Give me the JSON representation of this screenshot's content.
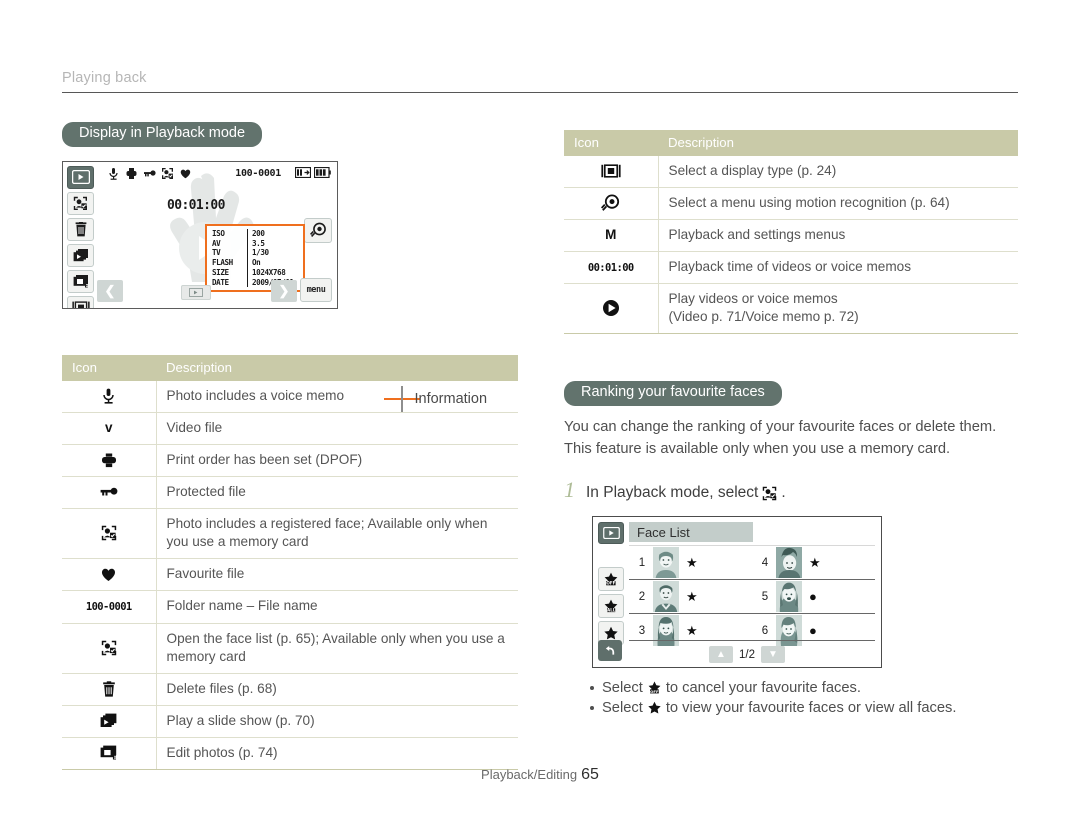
{
  "running_head": "Playing back",
  "footer": {
    "section": "Playback/Editing",
    "page": "65"
  },
  "left_column": {
    "section_title": "Display in Playback mode",
    "callout_label": "Information",
    "lcd": {
      "file_name": "100-0001",
      "playback_time": "00:01:00",
      "menu_label": "menu",
      "nav_prev": "❮",
      "nav_next": "❯",
      "top_icons": [
        "voice-memo-icon",
        "dpof-print-icon",
        "protect-key-icon",
        "registered-face-icon",
        "favourite-heart-icon"
      ],
      "left_buttons": [
        "display-type-icon",
        "face-list-icon",
        "delete-icon",
        "slide-show-icon",
        "edit-photo-icon",
        "display-select-icon"
      ],
      "right_button": "motion-recognition-icon",
      "info_box": {
        "rows": [
          {
            "key": "ISO",
            "value": "200"
          },
          {
            "key": "AV",
            "value": "3.5"
          },
          {
            "key": "TV",
            "value": "1/30"
          },
          {
            "key": "FLASH",
            "value": "On"
          },
          {
            "key": "SIZE",
            "value": "1024X768"
          },
          {
            "key": "DATE",
            "value": "2009/07/01"
          }
        ]
      }
    },
    "table": {
      "headers": [
        "Icon",
        "Description"
      ],
      "rows": [
        {
          "icon": "voice-memo-icon",
          "icon_kind": "svg",
          "icon_text": "",
          "desc": "Photo includes a voice memo"
        },
        {
          "icon": "video-file-icon",
          "icon_kind": "text",
          "icon_text": "v",
          "desc": "Video file"
        },
        {
          "icon": "dpof-print-icon",
          "icon_kind": "svg",
          "icon_text": "",
          "desc": "Print order has been set (DPOF)"
        },
        {
          "icon": "protect-key-icon",
          "icon_kind": "svg",
          "icon_text": "",
          "desc": "Protected file"
        },
        {
          "icon": "registered-face-icon",
          "icon_kind": "svg",
          "icon_text": "",
          "desc": "Photo includes a registered face; Available only when you use a memory card"
        },
        {
          "icon": "favourite-heart-icon",
          "icon_kind": "svg",
          "icon_text": "",
          "desc": "Favourite file"
        },
        {
          "icon": "folder-file-name-icon",
          "icon_kind": "mono",
          "icon_text": "100-0001",
          "desc": "Folder name – File name"
        },
        {
          "icon": "face-list-icon",
          "icon_kind": "svg",
          "icon_text": "",
          "desc": "Open the face list (p. 65); Available only when you use a memory card"
        },
        {
          "icon": "delete-icon",
          "icon_kind": "svg",
          "icon_text": "",
          "desc": "Delete files (p. 68)"
        },
        {
          "icon": "slide-show-icon",
          "icon_kind": "svg",
          "icon_text": "",
          "desc": "Play a slide show (p. 70)"
        },
        {
          "icon": "edit-photo-icon",
          "icon_kind": "svg",
          "icon_text": "",
          "desc": "Edit photos (p. 74)"
        }
      ]
    }
  },
  "right_column": {
    "table": {
      "headers": [
        "Icon",
        "Description"
      ],
      "rows": [
        {
          "icon": "display-select-icon",
          "icon_kind": "svg",
          "icon_text": "",
          "desc": "Select a display type (p. 24)"
        },
        {
          "icon": "motion-recognition-icon",
          "icon_kind": "svg",
          "icon_text": "",
          "desc": "Select a menu using motion recognition (p. 64)"
        },
        {
          "icon": "menu-m-icon",
          "icon_kind": "text",
          "icon_text": "M",
          "desc": "Playback and settings menus"
        },
        {
          "icon": "playback-time-icon",
          "icon_kind": "mono",
          "icon_text": "00:01:00",
          "desc": "Playback time of videos or voice memos"
        },
        {
          "icon": "play-icon",
          "icon_kind": "svg",
          "icon_text": "",
          "desc": "Play videos or voice memos\n(Video p. 71/Voice memo p. 72)"
        }
      ]
    },
    "section_title": "Ranking your favourite faces",
    "intro": "You can change the ranking of your favourite faces or delete them. This feature is available only when you use a memory card.",
    "step": {
      "number": "1",
      "text_before": "In Playback mode, select",
      "icon": "face-list-icon",
      "text_after": "."
    },
    "face_list": {
      "title": "Face List",
      "page_indicator": "1/2",
      "side_buttons": [
        "favourite-off-icon",
        "favourite-all-icon",
        "favourite-star-icon"
      ],
      "back_button": "back-arrow-icon",
      "entries": [
        {
          "index": "1",
          "mark": "star"
        },
        {
          "index": "2",
          "mark": "star"
        },
        {
          "index": "3",
          "mark": "star"
        },
        {
          "index": "4",
          "mark": "star"
        },
        {
          "index": "5",
          "mark": "dot"
        },
        {
          "index": "6",
          "mark": "dot"
        }
      ]
    },
    "bullets": [
      {
        "text_before": "Select",
        "icon": "favourite-off-icon",
        "text_after": "to cancel your favourite faces."
      },
      {
        "text_before": "Select",
        "icon": "favourite-star-icon",
        "text_after": "to view your favourite faces or view all faces."
      }
    ]
  },
  "colors": {
    "pill_bg": "#62736d",
    "table_header_bg": "#c9caa8",
    "accent_orange": "#ef6f1e",
    "step_number": "#aebc97",
    "lcd_button_bg": "#f2f3f1",
    "lcd_dark_button": "#5f6f6b"
  }
}
